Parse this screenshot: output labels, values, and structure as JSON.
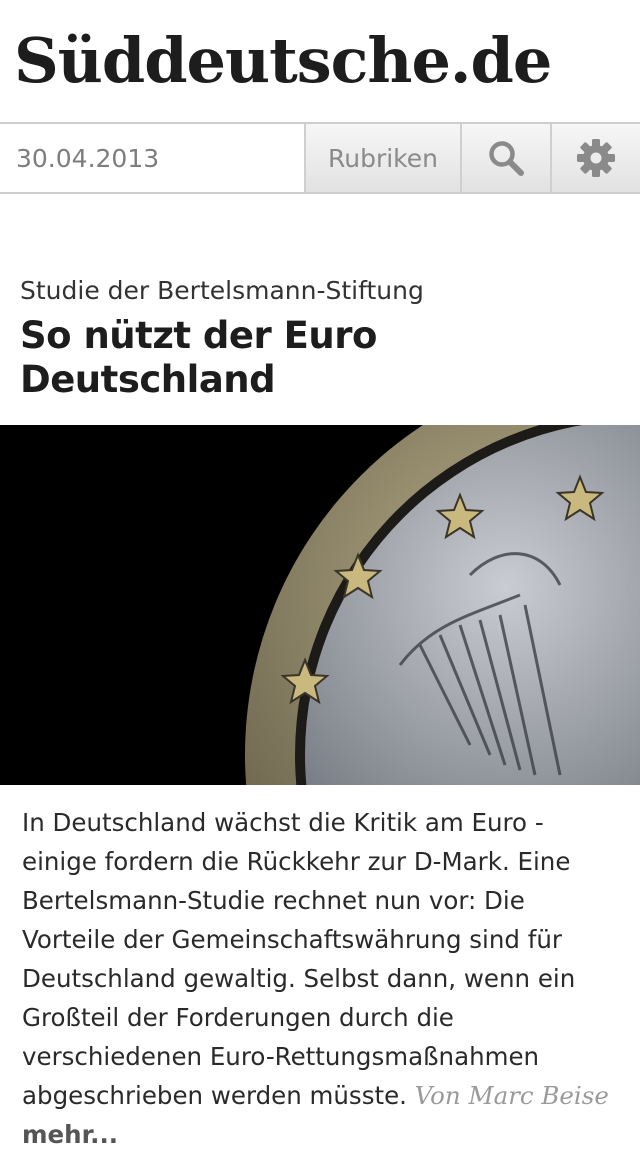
{
  "masthead": {
    "logo_text": "Süddeutsche.de"
  },
  "toolbar": {
    "date": "30.04.2013",
    "rubriken_label": "Rubriken",
    "search_icon": "search-icon",
    "settings_icon": "gear-icon"
  },
  "article": {
    "kicker": "Studie der Bertelsmann-Stiftung",
    "headline": "So nützt der Euro Deutschland",
    "image_subject": "euro-coin-image",
    "teaser": "In Deutschland wächst die Kritik am Euro - einige fordern die Rückkehr zur D-Mark. Eine Bertelsmann-Studie rechnet nun vor: Die Vorteile der Gemeinschaftswährung sind für Deutschland gewaltig. Selbst dann, wenn ein Großteil der Forderungen durch die verschiedenen Euro-Rettungsmaßnahmen abgeschrieben werden müsste.",
    "author": "Von Marc Beise",
    "more_label": "mehr..."
  }
}
